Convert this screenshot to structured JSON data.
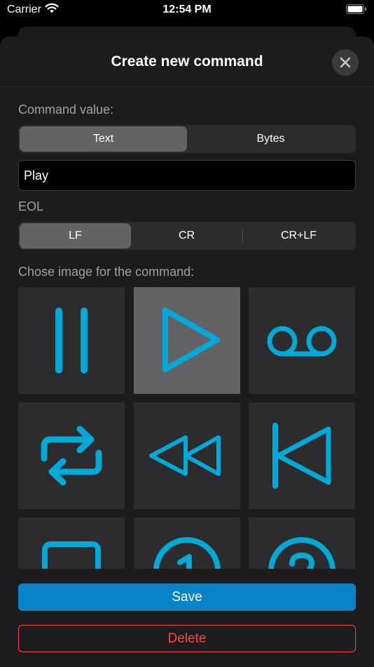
{
  "status": {
    "carrier": "Carrier",
    "time": "12:54 PM"
  },
  "header": {
    "title": "Create new command",
    "close_icon": "close-icon"
  },
  "command_value": {
    "label": "Command value:",
    "options": [
      "Text",
      "Bytes"
    ],
    "selected": "Text",
    "input_value": "Play"
  },
  "eol": {
    "label": "EOL",
    "options": [
      "LF",
      "CR",
      "CR+LF"
    ],
    "selected": "LF"
  },
  "image_picker": {
    "label": "Chose image for the command:",
    "icons": [
      "pause-icon",
      "play-icon",
      "voicemail-icon",
      "repeat-icon",
      "rewind-icon",
      "skip-back-icon",
      "stop-icon",
      "number-1-icon",
      "number-2-icon"
    ],
    "selected": "play-icon",
    "icon_color": "#00a9d6"
  },
  "actions": {
    "save_label": "Save",
    "delete_label": "Delete"
  },
  "colors": {
    "accent": "#0a84c8",
    "destructive": "#ff453a",
    "icon": "#00a9d6"
  }
}
